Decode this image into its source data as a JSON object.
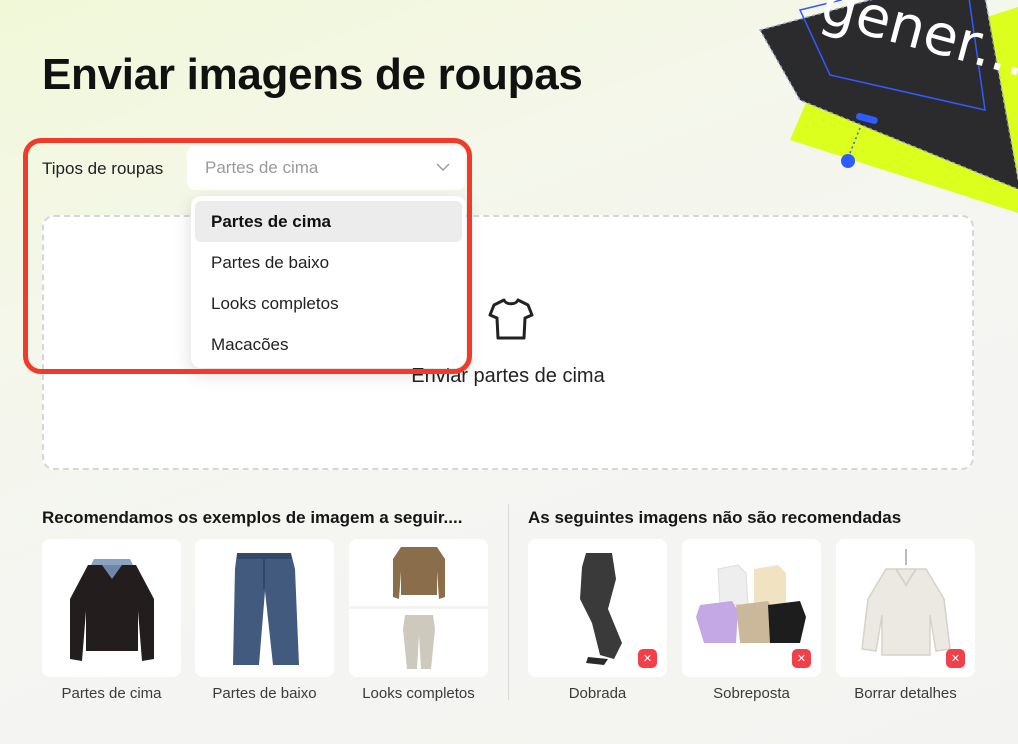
{
  "page": {
    "title": "Enviar imagens de roupas"
  },
  "decoration": {
    "text": "gener..."
  },
  "type_selector": {
    "label": "Tipos de roupas",
    "placeholder": "Partes de cima",
    "options": [
      "Partes de cima",
      "Partes de baixo",
      "Looks completos",
      "Macacões"
    ],
    "selected": "Partes de cima"
  },
  "dropzone": {
    "text": "Enviar partes de cima"
  },
  "recommended": {
    "title": "Recomendamos os exemplos de imagem a seguir....",
    "items": [
      {
        "caption": "Partes de cima"
      },
      {
        "caption": "Partes de baixo"
      },
      {
        "caption": "Looks completos"
      }
    ]
  },
  "not_recommended": {
    "title": "As seguintes imagens não são recomendadas",
    "items": [
      {
        "caption": "Dobrada"
      },
      {
        "caption": "Sobreposta"
      },
      {
        "caption": "Borrar detalhes"
      }
    ],
    "badge_icon": "close-icon"
  },
  "colors": {
    "highlight": "#f23a2a",
    "accent_lime": "#dcff1e",
    "badge_red": "#f2404a"
  }
}
